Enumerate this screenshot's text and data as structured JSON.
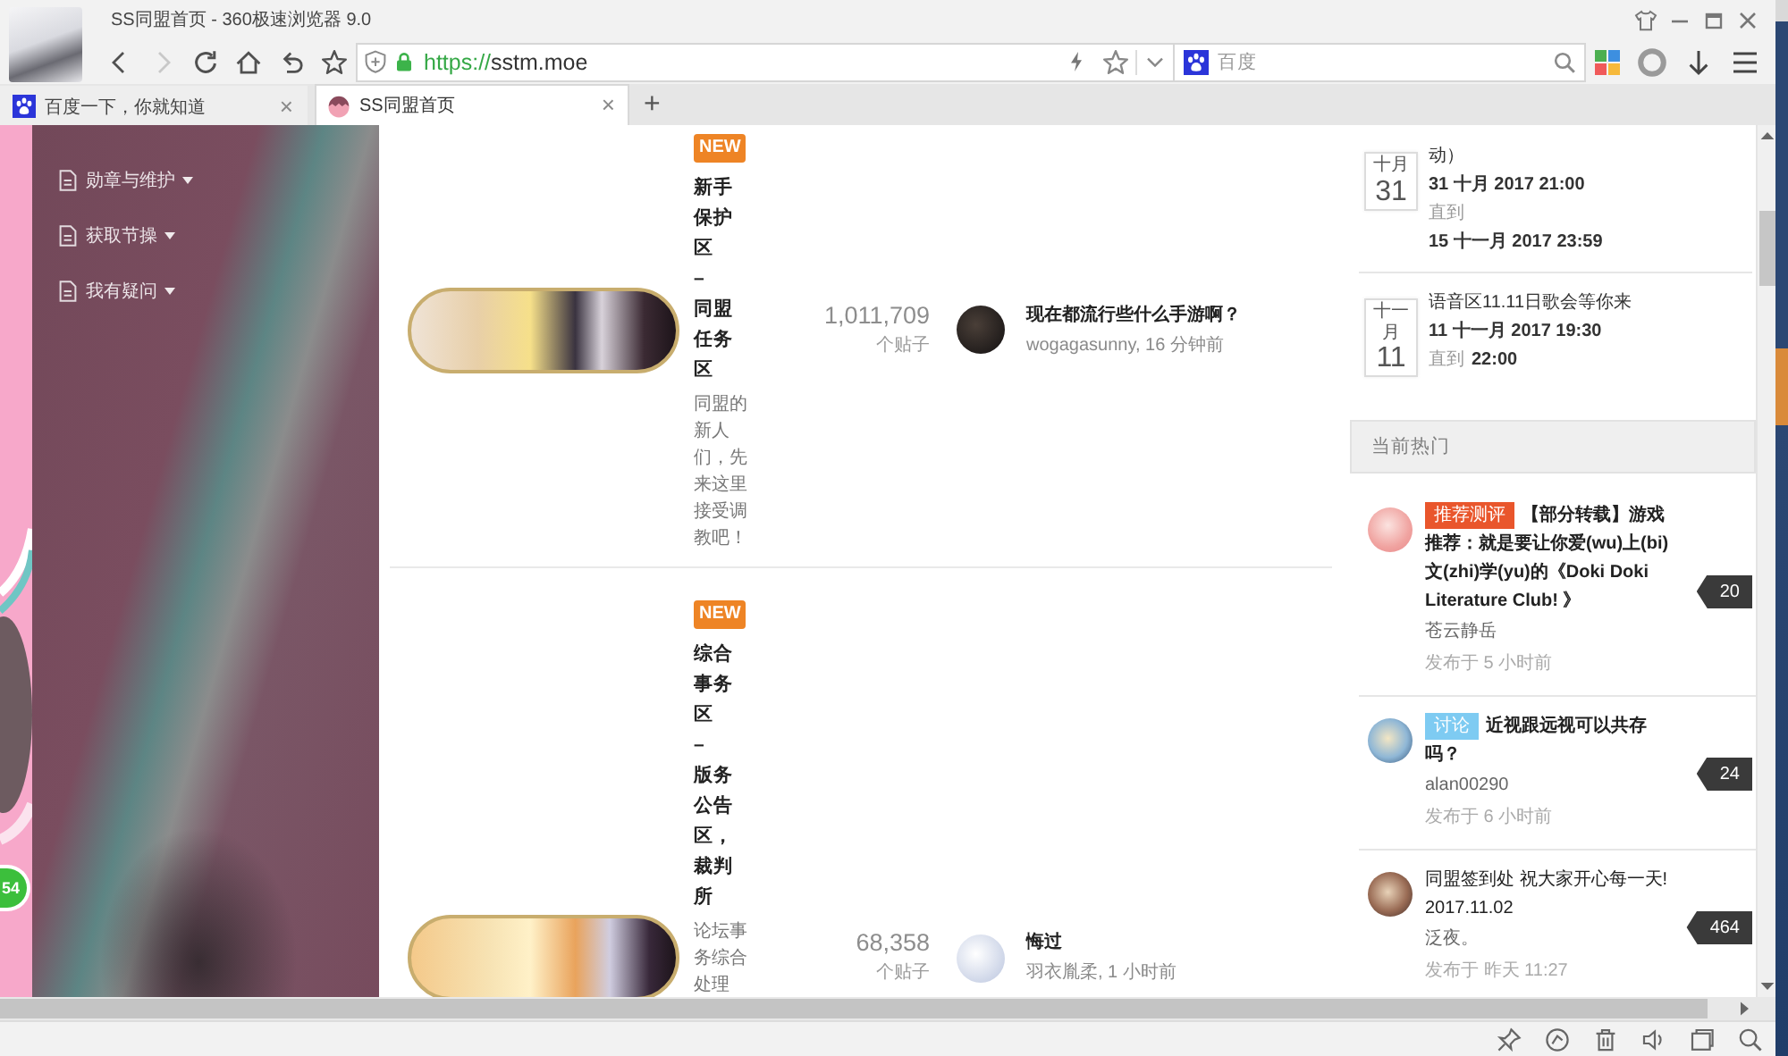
{
  "window": {
    "title": "SS同盟首页 - 360极速浏览器 9.0"
  },
  "toolbar": {
    "nav": [
      {
        "kind": "back",
        "disabled": false
      },
      {
        "kind": "forward",
        "disabled": true
      },
      {
        "kind": "reload",
        "disabled": false
      },
      {
        "kind": "home",
        "disabled": false
      },
      {
        "kind": "undo",
        "disabled": false
      },
      {
        "kind": "favorite",
        "disabled": false
      }
    ],
    "url": {
      "scheme": "https://",
      "host": "sstm.moe"
    },
    "search": {
      "placeholder": "百度"
    }
  },
  "tabs": [
    {
      "label": "百度一下，你就知道",
      "selected": false,
      "close": "×"
    },
    {
      "label": "SS同盟首页",
      "selected": true,
      "close": "×"
    }
  ],
  "new_tab": "+",
  "sidebar": {
    "items": [
      {
        "label": "勋章与维护"
      },
      {
        "label": "获取节操"
      },
      {
        "label": "我有疑问"
      }
    ]
  },
  "side_badge": "54",
  "forums": [
    {
      "badge": "NEW",
      "title": "新手保护区 – 同盟任务区",
      "description": "同盟的新人们，先来这里接受调教吧！",
      "count": "1,011,709",
      "count_label": "个贴子",
      "last_post": {
        "title": "现在都流行些什么手游啊？",
        "meta": "wogagasunny, 16 分钟前"
      }
    },
    {
      "badge": "NEW",
      "title": "综合事务区 – 版务公告区，裁判所",
      "description": "论坛事务综合处理",
      "count": "68,358",
      "count_label": "个贴子",
      "last_post": {
        "title": "悔过",
        "meta": "羽衣胤柔, 1 小时前"
      }
    }
  ],
  "events": [
    {
      "month": "十月",
      "day": "31",
      "title": "动）",
      "start": "31 十月 2017 21:00",
      "until": "直到",
      "end": "15 十一月 2017 23:59"
    },
    {
      "month": "十一月",
      "day": "11",
      "title": "语音区11.11日歌会等你来",
      "start": "11 十一月 2017 19:30",
      "until": "直到",
      "end": "22:00"
    }
  ],
  "hot": {
    "title": "当前热门",
    "items": [
      {
        "tag": {
          "label": "推荐测评",
          "color": "#e9562c"
        },
        "title": "【部分转载】游戏推荐：就是要让你爱(wu)上(bi)文(zhi)学(yu)的《Doki Doki Literature Club! 》",
        "bold": true,
        "author": "苍云静岳",
        "time": "发布于 5 小时前",
        "count": "20"
      },
      {
        "tag": {
          "label": "讨论",
          "color": "#7ecbf2"
        },
        "title": "近视跟远视可以共存吗？",
        "bold": true,
        "author": "alan00290",
        "time": "发布于 6 小时前",
        "count": "24"
      },
      {
        "title": "同盟签到处 祝大家开心每一天! 2017.11.02",
        "bold": false,
        "author": "泛夜。",
        "time": "发布于 昨天 11:27",
        "count": "464"
      }
    ]
  }
}
